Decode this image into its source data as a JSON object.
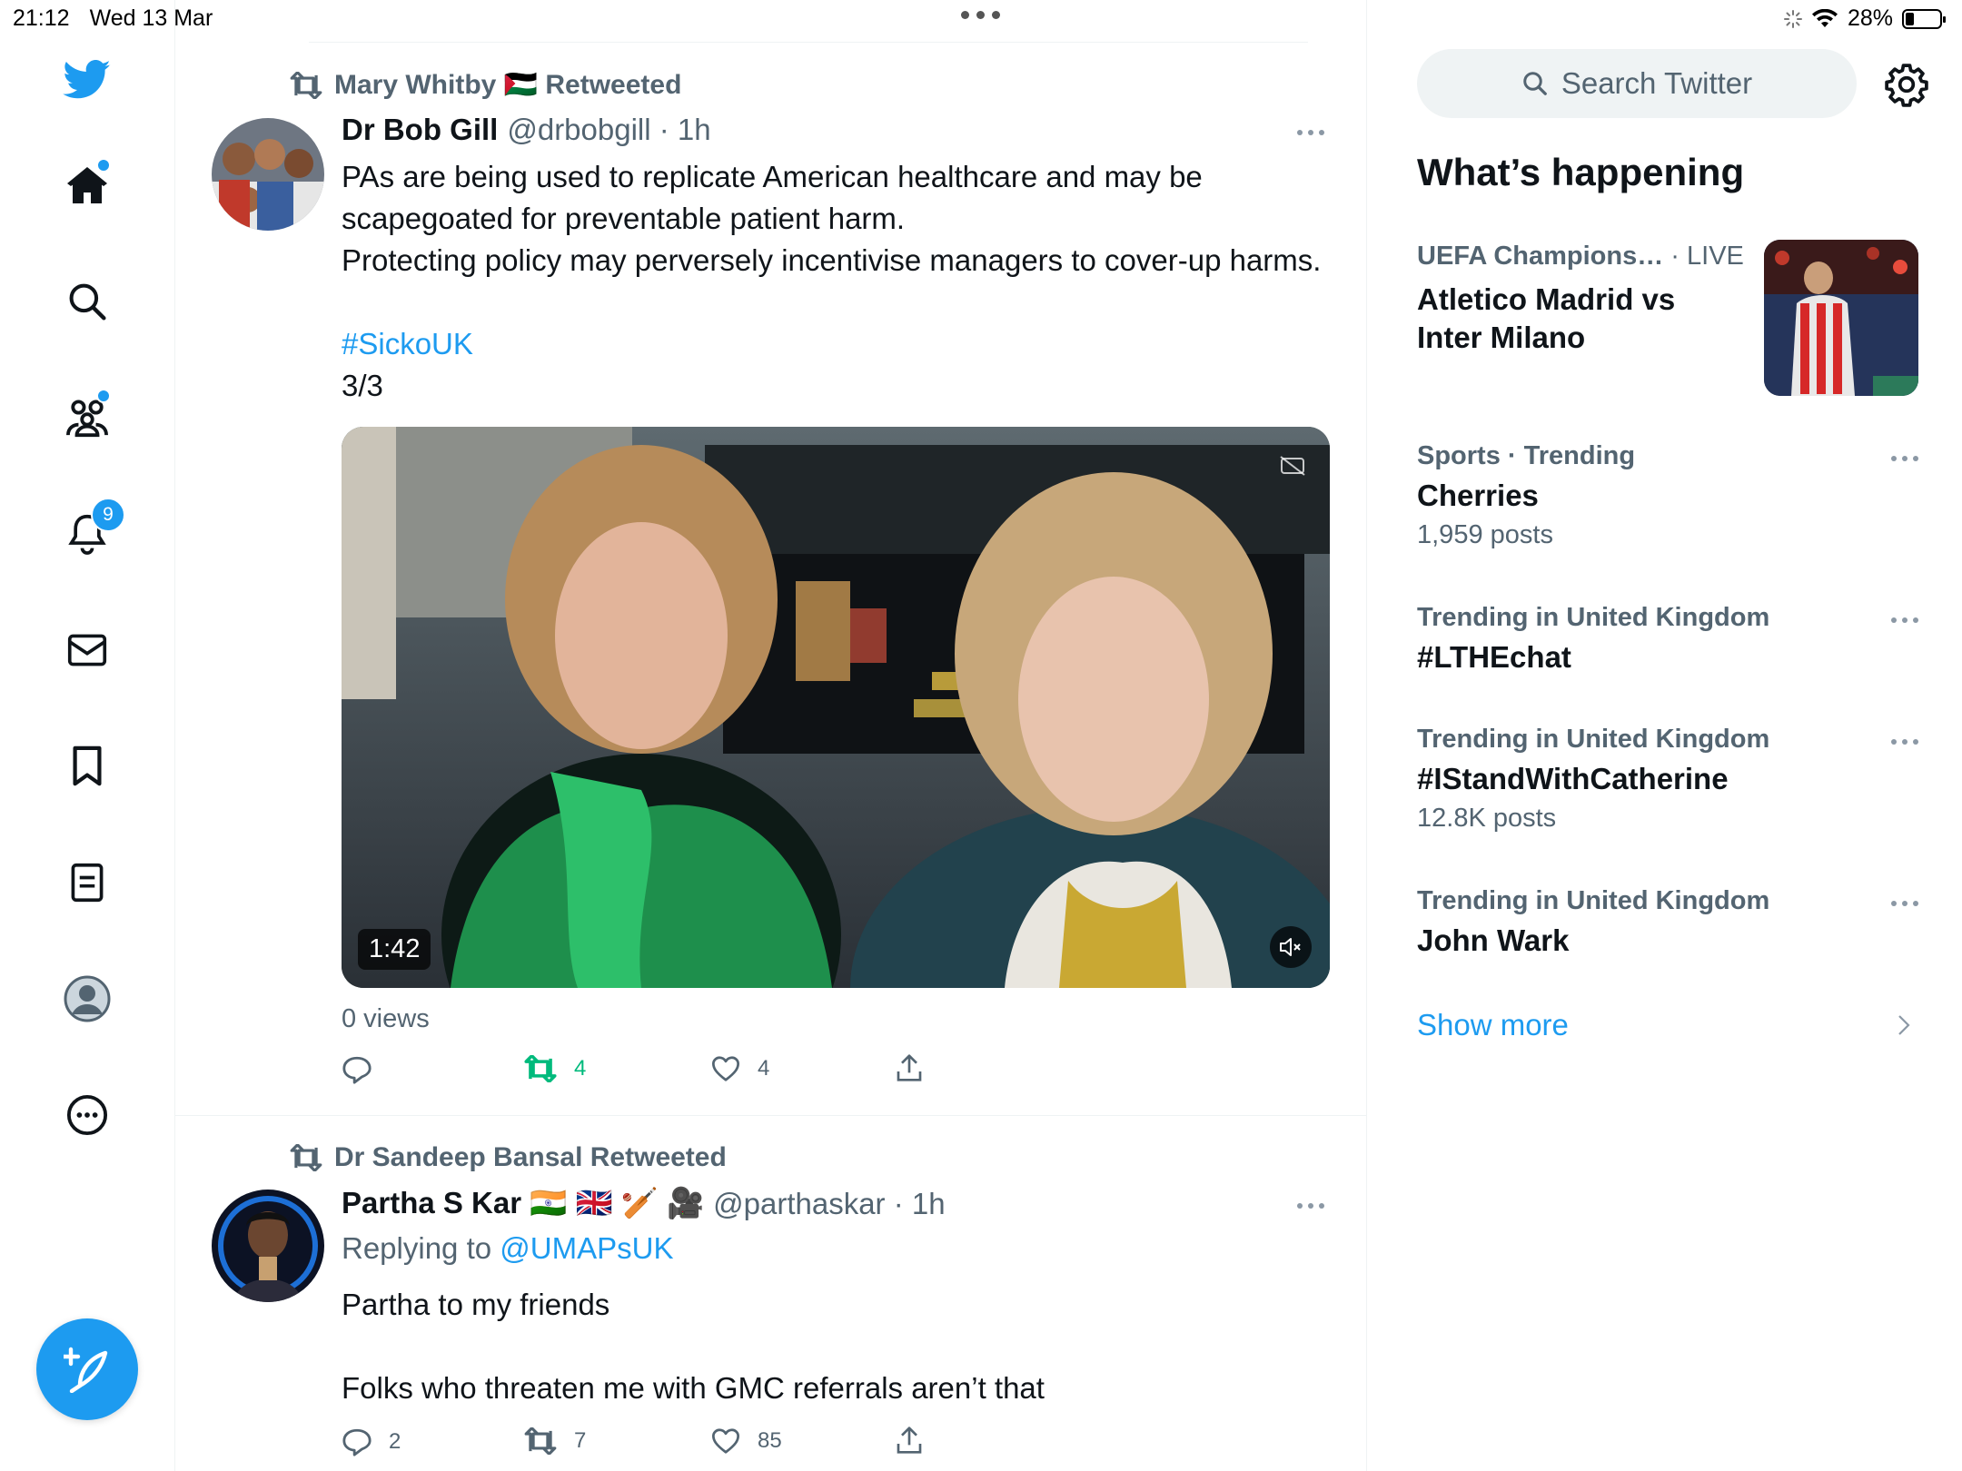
{
  "status_bar": {
    "time": "21:12",
    "date": "Wed 13 Mar",
    "battery": "28%",
    "battery_level": 0.28
  },
  "nav": {
    "items": [
      "home-icon",
      "search-icon",
      "communities-icon",
      "notifications-icon",
      "messages-icon",
      "bookmarks-icon",
      "lists-icon",
      "profile-icon",
      "more-icon"
    ],
    "notifications_badge": "9",
    "compose_icon": "compose-icon"
  },
  "colors": {
    "brand": "#1d9bf0",
    "retweet_green": "#00ba7c",
    "secondary_text": "#536471"
  },
  "feed": {
    "tweet1": {
      "retweeted_by": "Mary Whitby 🇵🇸 Retweeted",
      "name": "Dr Bob Gill",
      "handle": "@drbobgill · 1h",
      "text": "PAs are being used to replicate American healthcare and may be scapegoated for preventable patient harm.\nProtecting policy may perversely incentivise managers to cover-up harms.",
      "hashtag": "#SickoUK",
      "thread_count": "3/3",
      "video_duration": "1:42",
      "views": "0 views",
      "retweets": "4",
      "likes": "4"
    },
    "tweet2": {
      "retweeted_by": "Dr Sandeep Bansal Retweeted",
      "name": "Partha S Kar 🇮🇳 🇬🇧 🏏 🎥",
      "handle": "@parthaskar · 1h",
      "replying_label": "Replying to",
      "replying_to": "@UMAPsUK",
      "text_line1": "Partha to my friends",
      "text_line2": "Folks who threaten me with GMC referrals aren’t that",
      "replies": "2",
      "retweets": "7",
      "likes": "85"
    }
  },
  "sidebar": {
    "search_placeholder": "Search Twitter",
    "whats_happening": "What’s happening",
    "trends": [
      {
        "meta": "UEFA Champions…",
        "live": "· LIVE",
        "title": "Atletico Madrid vs Inter Milano"
      },
      {
        "meta": "Sports · Trending",
        "title": "Cherries",
        "count": "1,959 posts"
      },
      {
        "meta": "Trending in United Kingdom",
        "title": "#LTHEchat"
      },
      {
        "meta": "Trending in United Kingdom",
        "title": "#IStandWithCatherine",
        "count": "12.8K posts"
      },
      {
        "meta": "Trending in United Kingdom",
        "title": "John Wark"
      }
    ],
    "show_more": "Show more"
  }
}
